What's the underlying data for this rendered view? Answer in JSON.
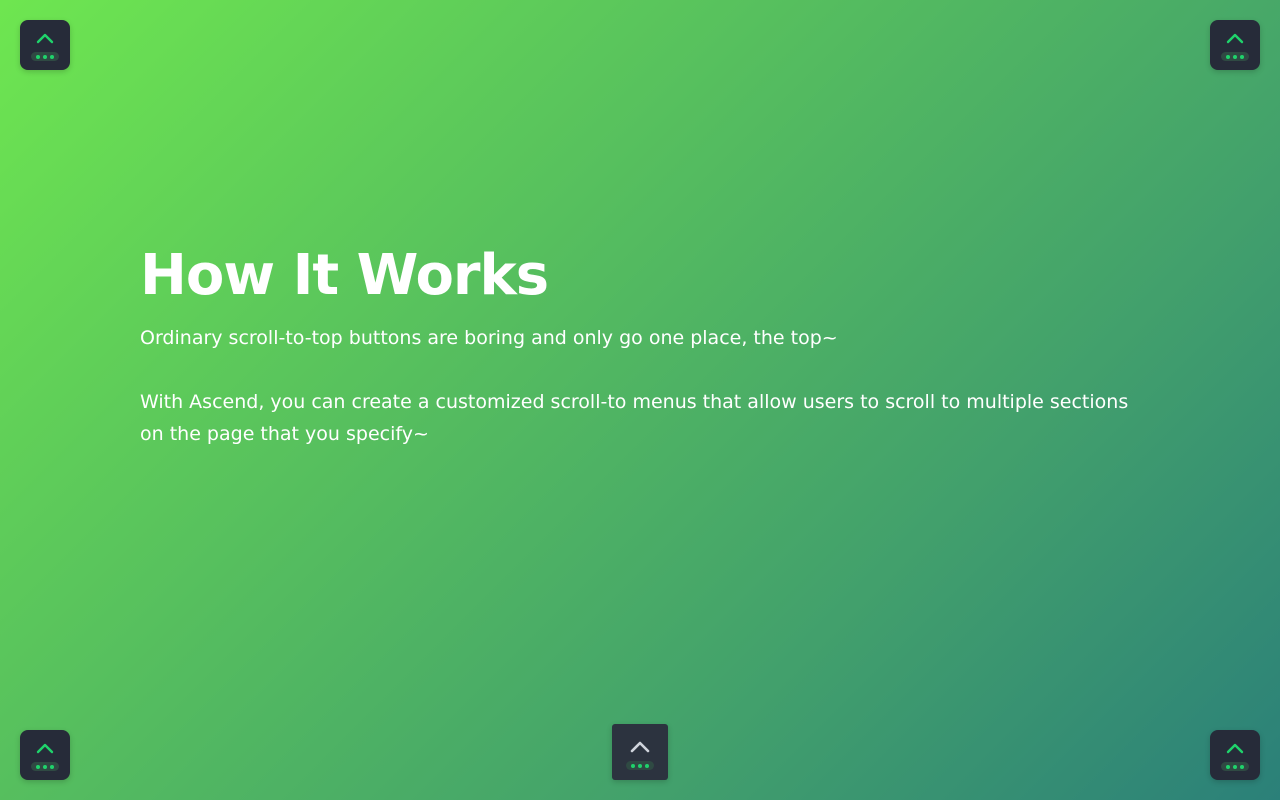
{
  "section": {
    "title": "How It Works",
    "paragraphs": [
      "Ordinary scroll-to-top buttons are boring and only go one place, the top~",
      "With Ascend, you can create a customized scroll-to menus that allow users to scroll to multiple sections on the page that you specify~"
    ]
  },
  "ascend_buttons": {
    "icon": "chevron-up-icon",
    "menu_indicator": "three-dots-icon",
    "items": [
      {
        "position": "top-left",
        "chevron_color": "#1fd36b"
      },
      {
        "position": "top-right",
        "chevron_color": "#1fd36b"
      },
      {
        "position": "bottom-left",
        "chevron_color": "#1fd36b"
      },
      {
        "position": "bottom-center",
        "chevron_color": "#d0d4dc"
      },
      {
        "position": "bottom-right",
        "chevron_color": "#1fd36b"
      }
    ]
  },
  "colors": {
    "background_gradient_start": "#6ee650",
    "background_gradient_end": "#2b8079",
    "button_bg": "#262b39",
    "accent": "#1fd36b",
    "text": "#ffffff"
  }
}
